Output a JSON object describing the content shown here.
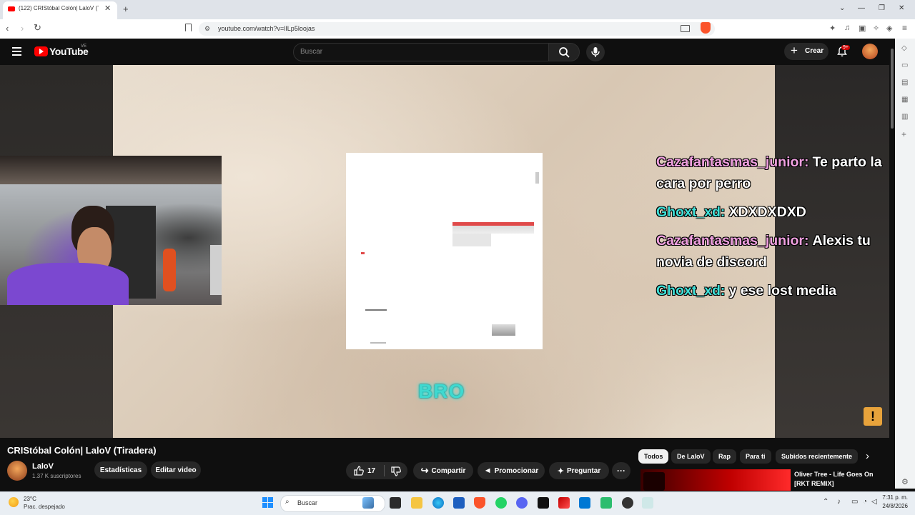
{
  "browser": {
    "tab_title": "(122) CRIStóbal Colón| LaloV (Ti",
    "url": "youtube.com/watch?v=lILp5loojas"
  },
  "youtube": {
    "logo_text": "YouTube",
    "region": "VE",
    "search_placeholder": "Buscar",
    "create_label": "Crear",
    "notif_count": "9+"
  },
  "video": {
    "overlay_text": "BRO",
    "chat": [
      {
        "user": "Cazafantasmas_junior:",
        "message": "Te parto la cara por perro",
        "color": "#f0a0e0"
      },
      {
        "user": "Ghoxt_xd:",
        "message": "XDXDXDXD",
        "color": "#3fe0d8"
      },
      {
        "user": "Cazafantasmas_junior:",
        "message": "Alexis tu novia de discord",
        "color": "#f0a0e0"
      },
      {
        "user": "Ghoxt_xd:",
        "message": "y ese lost media",
        "color": "#3fe0d8"
      }
    ],
    "alert_symbol": "!"
  },
  "details": {
    "title": "CRIStóbal Colón| LaloV (Tiradera)",
    "channel_name": "LaloV",
    "subscribers": "1.37 K suscriptores",
    "stats_btn": "Estadísticas",
    "edit_btn": "Editar video",
    "likes": "17",
    "share_btn": "Compartir",
    "promote_btn": "Promocionar",
    "ask_btn": "Preguntar"
  },
  "chips": [
    "Todos",
    "De LaloV",
    "Rap",
    "Para ti",
    "Subidos recientemente"
  ],
  "recommendation": {
    "title": "Oliver Tree - Life Goes On [RKT REMIX]"
  },
  "taskbar": {
    "weather_temp": "23°C",
    "weather_desc": "Prac. despejado",
    "search_label": "Buscar",
    "time": "7:31 p. m.",
    "date": "24/8/2026"
  }
}
